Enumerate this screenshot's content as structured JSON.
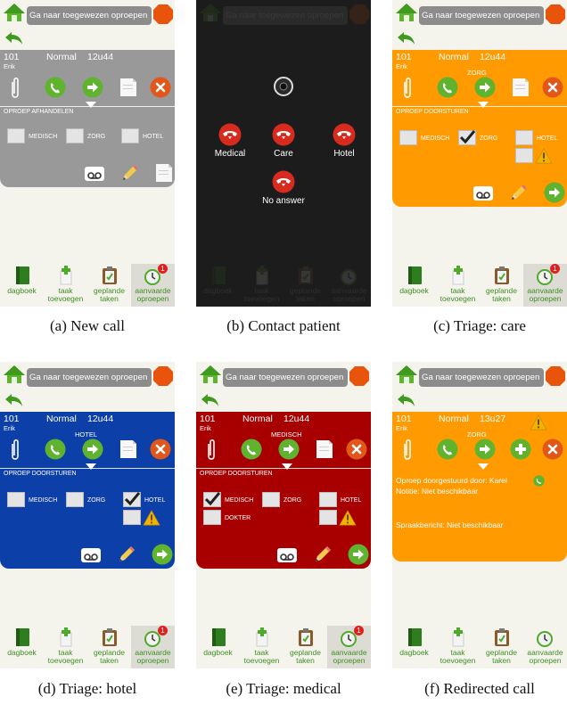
{
  "colors": {
    "gray": "#999999",
    "orange": "#ff9a00",
    "blue": "#0d3fa8",
    "red": "#a80000",
    "green": "#58b52c",
    "navgreen": "#3f8f25"
  },
  "icons": {
    "home": "home-icon",
    "back": "back-arrow-icon",
    "stop": "stop-sign-icon",
    "attach": "paperclip-icon",
    "answer": "phone-answer-icon",
    "forward": "forward-arrow-icon",
    "note": "note-icon",
    "close": "close-icon",
    "voicemail": "voicemail-icon",
    "pencil": "pencil-icon",
    "warning": "warning-icon",
    "add": "plus-icon"
  },
  "search_text": "Ga naar toegewezen oproepen",
  "nav": {
    "dagboek": "dagboek",
    "taak_1": "taak",
    "taak_2": "toevoegen",
    "geplande_1": "geplande",
    "geplande_2": "taken",
    "aanvaarde_1": "aanvaarde",
    "aanvaarde_2": "oproepen",
    "badge": "1"
  },
  "panels": {
    "a": {
      "caption": "(a) New call",
      "number": "101",
      "priority": "Normal",
      "time": "12u44",
      "name": "Erik",
      "category": "",
      "section": "OPROEP AFHANDELEN",
      "checks": {
        "medisch": "MEDISCH",
        "zorg": "ZORG",
        "hotel": "HOTEL"
      }
    },
    "b": {
      "caption": "(b) Contact patient",
      "options": {
        "medical": "Medical",
        "care": "Care",
        "hotel": "Hotel",
        "no_answer": "No answer"
      }
    },
    "c": {
      "caption": "(c) Triage: care",
      "number": "101",
      "priority": "Normal",
      "time": "12u44",
      "name": "Erik",
      "category": "ZORG",
      "section": "OPROEP DOORSTUREN",
      "checks": {
        "medisch": "MEDISCH",
        "zorg": "ZORG",
        "hotel": "HOTEL"
      }
    },
    "d": {
      "caption": "(d) Triage: hotel",
      "number": "101",
      "priority": "Normal",
      "time": "12u44",
      "name": "Erik",
      "category": "HOTEL",
      "section": "OPROEP DOORSTUREN",
      "checks": {
        "medisch": "MEDISCH",
        "zorg": "ZORG",
        "hotel": "HOTEL"
      }
    },
    "e": {
      "caption": "(e) Triage: medical",
      "number": "101",
      "priority": "Normal",
      "time": "12u44",
      "name": "Erik",
      "category": "MEDISCH",
      "section": "OPROEP DOORSTUREN",
      "checks": {
        "medisch": "MEDISCH",
        "zorg": "ZORG",
        "hotel": "HOTEL",
        "dokter": "DOKTER"
      }
    },
    "f": {
      "caption": "(f) Redirected call",
      "number": "101",
      "priority": "Normal",
      "time": "13u27",
      "name": "Erik",
      "category": "ZORG",
      "forwarded_by": "Oproep doorgestuurd door: Karel",
      "note": "Notitie: Niet beschikbaar",
      "voicemail": "Spraakbericht: Niet beschikbaar"
    }
  }
}
